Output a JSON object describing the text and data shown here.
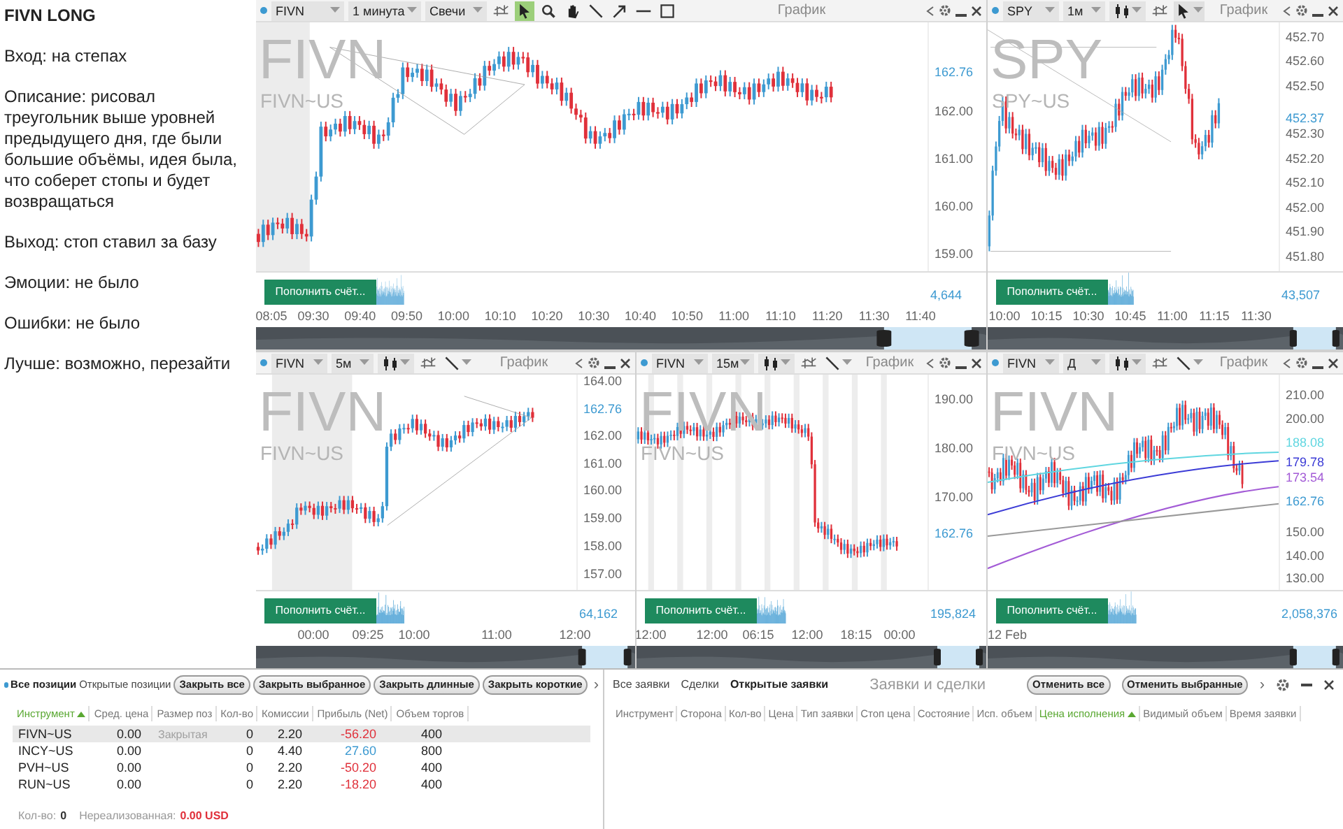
{
  "notes": {
    "title": "FIVN LONG",
    "paragraphs": [
      "Вход: на степах",
      "Описание: рисовал треугольник выше уровней предыдущего дня, где были большие объёмы, идея была, что соберет стопы и будет возвращаться",
      "Выход: стоп ставил за базу",
      "Эмоции: не было",
      "Ошибки: не было",
      "Лучше: возможно, перезайти"
    ]
  },
  "charts": [
    {
      "symbol": "FIVN",
      "timeframe": "1 минута",
      "chart_type": "Свечи",
      "title": "График",
      "watermark": "FIVN",
      "watermark_sub": "FIVN~US",
      "tools": [
        {
          "kind": "indicators",
          "selected": false
        },
        {
          "kind": "cursor",
          "selected": true
        },
        {
          "kind": "zoom",
          "selected": false
        },
        {
          "kind": "pan",
          "selected": false
        },
        {
          "kind": "line",
          "selected": false
        },
        {
          "kind": "arrow",
          "selected": false
        },
        {
          "kind": "hline",
          "selected": false
        },
        {
          "kind": "rect",
          "selected": false
        }
      ],
      "price_ticks": [
        "162.00",
        "161.00",
        "160.00",
        "159.00"
      ],
      "markers": [
        {
          "text": "162.76",
          "color": "#3d9ad1"
        }
      ],
      "volume": "4,644",
      "deposit_button": "Пополнить счёт...",
      "time_labels": [
        "08:05",
        "09:30",
        "09:40",
        "09:50",
        "10:00",
        "10:10",
        "10:20",
        "10:30",
        "10:40",
        "10:50",
        "11:00",
        "11:10",
        "11:20",
        "11:30",
        "11:40"
      ]
    },
    {
      "symbol": "SPY",
      "timeframe": "1м",
      "title": "График",
      "watermark": "SPY",
      "watermark_sub": "SPY~US",
      "tools": [
        {
          "kind": "indicators",
          "selected": false
        },
        {
          "kind": "cursor",
          "selected": true
        }
      ],
      "price_ticks": [
        "452.70",
        "452.60",
        "452.50",
        "452.30",
        "452.20",
        "452.10",
        "452.00",
        "451.90",
        "451.80"
      ],
      "markers": [
        {
          "text": "452.37",
          "color": "#3d9ad1"
        }
      ],
      "volume": "43,507",
      "deposit_button": "Пополнить счёт...",
      "time_labels": [
        "10:00",
        "10:15",
        "10:30",
        "10:45",
        "11:00",
        "11:15",
        "11:30"
      ]
    },
    {
      "symbol": "FIVN",
      "timeframe": "5м",
      "title": "График",
      "watermark": "FIVN",
      "watermark_sub": "FIVN~US",
      "tools": [
        {
          "kind": "indicators",
          "selected": false
        },
        {
          "kind": "line",
          "selected": false
        }
      ],
      "price_ticks": [
        "164.00",
        "162.00",
        "161.00",
        "160.00",
        "159.00",
        "158.00",
        "157.00"
      ],
      "markers": [
        {
          "text": "162.76",
          "color": "#3d9ad1"
        }
      ],
      "volume": "64,162",
      "deposit_button": "Пополнить счёт...",
      "time_labels": [
        "00:00",
        "09:25",
        "10:00",
        "11:00",
        "12:00"
      ]
    },
    {
      "symbol": "FIVN",
      "timeframe": "15м",
      "title": "График",
      "watermark": "FIVN",
      "watermark_sub": "FIVN~US",
      "tools": [
        {
          "kind": "indicators",
          "selected": false
        },
        {
          "kind": "line",
          "selected": false
        }
      ],
      "price_ticks": [
        "190.00",
        "180.00",
        "170.00"
      ],
      "markers": [
        {
          "text": "162.76",
          "color": "#3d9ad1"
        }
      ],
      "volume": "195,824",
      "deposit_button": "Пополнить счёт...",
      "time_labels": [
        "12:00",
        "12:00",
        "06:15",
        "12:00",
        "18:15",
        "00:00"
      ]
    },
    {
      "symbol": "FIVN",
      "timeframe": "Д",
      "title": "График",
      "watermark": "FIVN",
      "watermark_sub": "FIVN~US",
      "tools": [
        {
          "kind": "indicators",
          "selected": false
        },
        {
          "kind": "line",
          "selected": false
        }
      ],
      "price_ticks": [
        "210.00",
        "200.00",
        "150.00",
        "140.00",
        "130.00"
      ],
      "markers": [
        {
          "text": "188.08",
          "color": "#5fd6e0"
        },
        {
          "text": "179.78",
          "color": "#3b3bd6"
        },
        {
          "text": "173.54",
          "color": "#a35bd6"
        },
        {
          "text": "162.76",
          "color": "#3d9ad1"
        }
      ],
      "volume": "2,058,376",
      "deposit_button": "Пополнить счёт...",
      "time_labels": [
        "12 Feb"
      ]
    }
  ],
  "positions": {
    "tabs": [
      {
        "label": "Все позиции",
        "selected": true
      },
      {
        "label": "Открытые позиции",
        "selected": false
      }
    ],
    "buttons": [
      "Закрыть все",
      "Закрыть выбранное",
      "Закрыть длинные",
      "Закрыть короткие"
    ],
    "more": "›",
    "columns": [
      {
        "label": "Инструмент",
        "sorted": true
      },
      {
        "label": "Сред. цена",
        "sorted": false
      },
      {
        "label": "Размер поз",
        "sorted": false
      },
      {
        "label": "Кол-во",
        "sorted": false
      },
      {
        "label": "Комиссии",
        "sorted": false
      },
      {
        "label": "Прибыль (Net)",
        "sorted": false
      },
      {
        "label": "Объем торгов",
        "sorted": false
      }
    ],
    "rows": [
      {
        "selected": true,
        "instrument": "FIVN~US",
        "avg_price": "0.00",
        "size": "Закрытая",
        "qty": "0",
        "commission": "2.20",
        "profit": "-56.20",
        "color": "#e0303a",
        "volume": "400"
      },
      {
        "selected": false,
        "instrument": "INCY~US",
        "avg_price": "0.00",
        "qty": "0",
        "commission": "4.40",
        "profit": "27.60",
        "color": "#3d9ad1",
        "volume": "800"
      },
      {
        "selected": false,
        "instrument": "PVH~US",
        "avg_price": "0.00",
        "qty": "0",
        "commission": "2.20",
        "profit": "-50.20",
        "color": "#e0303a",
        "volume": "400"
      },
      {
        "selected": false,
        "instrument": "RUN~US",
        "avg_price": "0.00",
        "qty": "0",
        "commission": "2.20",
        "profit": "-18.20",
        "color": "#e0303a",
        "volume": "400"
      }
    ],
    "footer": {
      "qty_label": "Кол-во:",
      "qty": "0",
      "unrealized_label": "Нереализованная:",
      "unrealized": "0.00 USD"
    }
  },
  "orders": {
    "tabs": [
      {
        "label": "Все заявки",
        "selected": false
      },
      {
        "label": "Сделки",
        "selected": false
      },
      {
        "label": "Открытые заявки",
        "selected": true
      }
    ],
    "title": "Заявки и сделки",
    "buttons": [
      "Отменить все",
      "Отменить выбранные"
    ],
    "more": "›",
    "columns": [
      {
        "label": "Инструмент",
        "sorted": false
      },
      {
        "label": "Сторона",
        "sorted": false
      },
      {
        "label": "Кол-во",
        "sorted": false
      },
      {
        "label": "Цена",
        "sorted": false
      },
      {
        "label": "Тип заявки",
        "sorted": false
      },
      {
        "label": "Стоп цена",
        "sorted": false
      },
      {
        "label": "Состояние",
        "sorted": false
      },
      {
        "label": "Исп. объем",
        "sorted": false
      },
      {
        "label": "Цена исполнения",
        "sorted": true
      },
      {
        "label": "Видимый объем",
        "sorted": false
      },
      {
        "label": "Время заявки",
        "sorted": false
      }
    ]
  }
}
